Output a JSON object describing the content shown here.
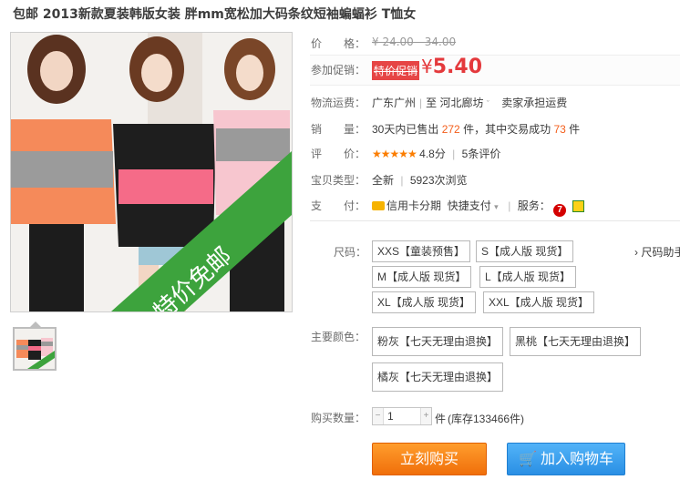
{
  "product": {
    "title": "包邮 2013新款夏装韩版女装 胖mm宽松加大码条纹短袖蝙蝠衫 T恤女",
    "image_banner_text": "特价免邮"
  },
  "price": {
    "label": "价　　格：",
    "original": "¥ 24.00 - 34.00"
  },
  "promo": {
    "label": "参加促销：",
    "tag": "特价促销",
    "currency": "¥",
    "value": "5.40"
  },
  "shipping": {
    "label": "物流运费：",
    "from": "广东广州",
    "to_prefix": "至",
    "to": "河北廊坊",
    "note": "卖家承担运费"
  },
  "sales": {
    "label": "销　　量：",
    "prefix": "30天内已售出",
    "sold": "272",
    "mid": "件，其中交易成功",
    "success": "73",
    "suffix": "件"
  },
  "rating": {
    "label": "评　　价：",
    "stars": "★★★★★",
    "score": "4.8分",
    "reviews": "5条评价"
  },
  "type": {
    "label": "宝贝类型：",
    "condition": "全新",
    "views": "5923次浏览"
  },
  "payment": {
    "label": "支　　付：",
    "credit": "信用卡分期",
    "quick": "快捷支付",
    "service_label": "服务：",
    "service_icon_text": "7"
  },
  "size": {
    "label": "尺码：",
    "helper": "尺码助手",
    "options": [
      "XXS【童装预售】",
      "S【成人版 现货】",
      "M【成人版 现货】",
      "L【成人版 现货】",
      "XL【成人版 现货】",
      "XXL【成人版 现货】"
    ]
  },
  "color": {
    "label": "主要颜色：",
    "options": [
      "粉灰【七天无理由退换】",
      "黑桃【七天无理由退换】",
      "橘灰【七天无理由退换】"
    ]
  },
  "quantity": {
    "label": "购买数量：",
    "value": "1",
    "unit": "件",
    "stock": "(库存133466件)"
  },
  "actions": {
    "buy": "立刻购买",
    "cart": "加入购物车"
  },
  "colors": {
    "accent_orange": "#f35e1b",
    "price_red": "#e4393c",
    "buy_button": "#f58a1f",
    "cart_button": "#3a9ff0"
  }
}
